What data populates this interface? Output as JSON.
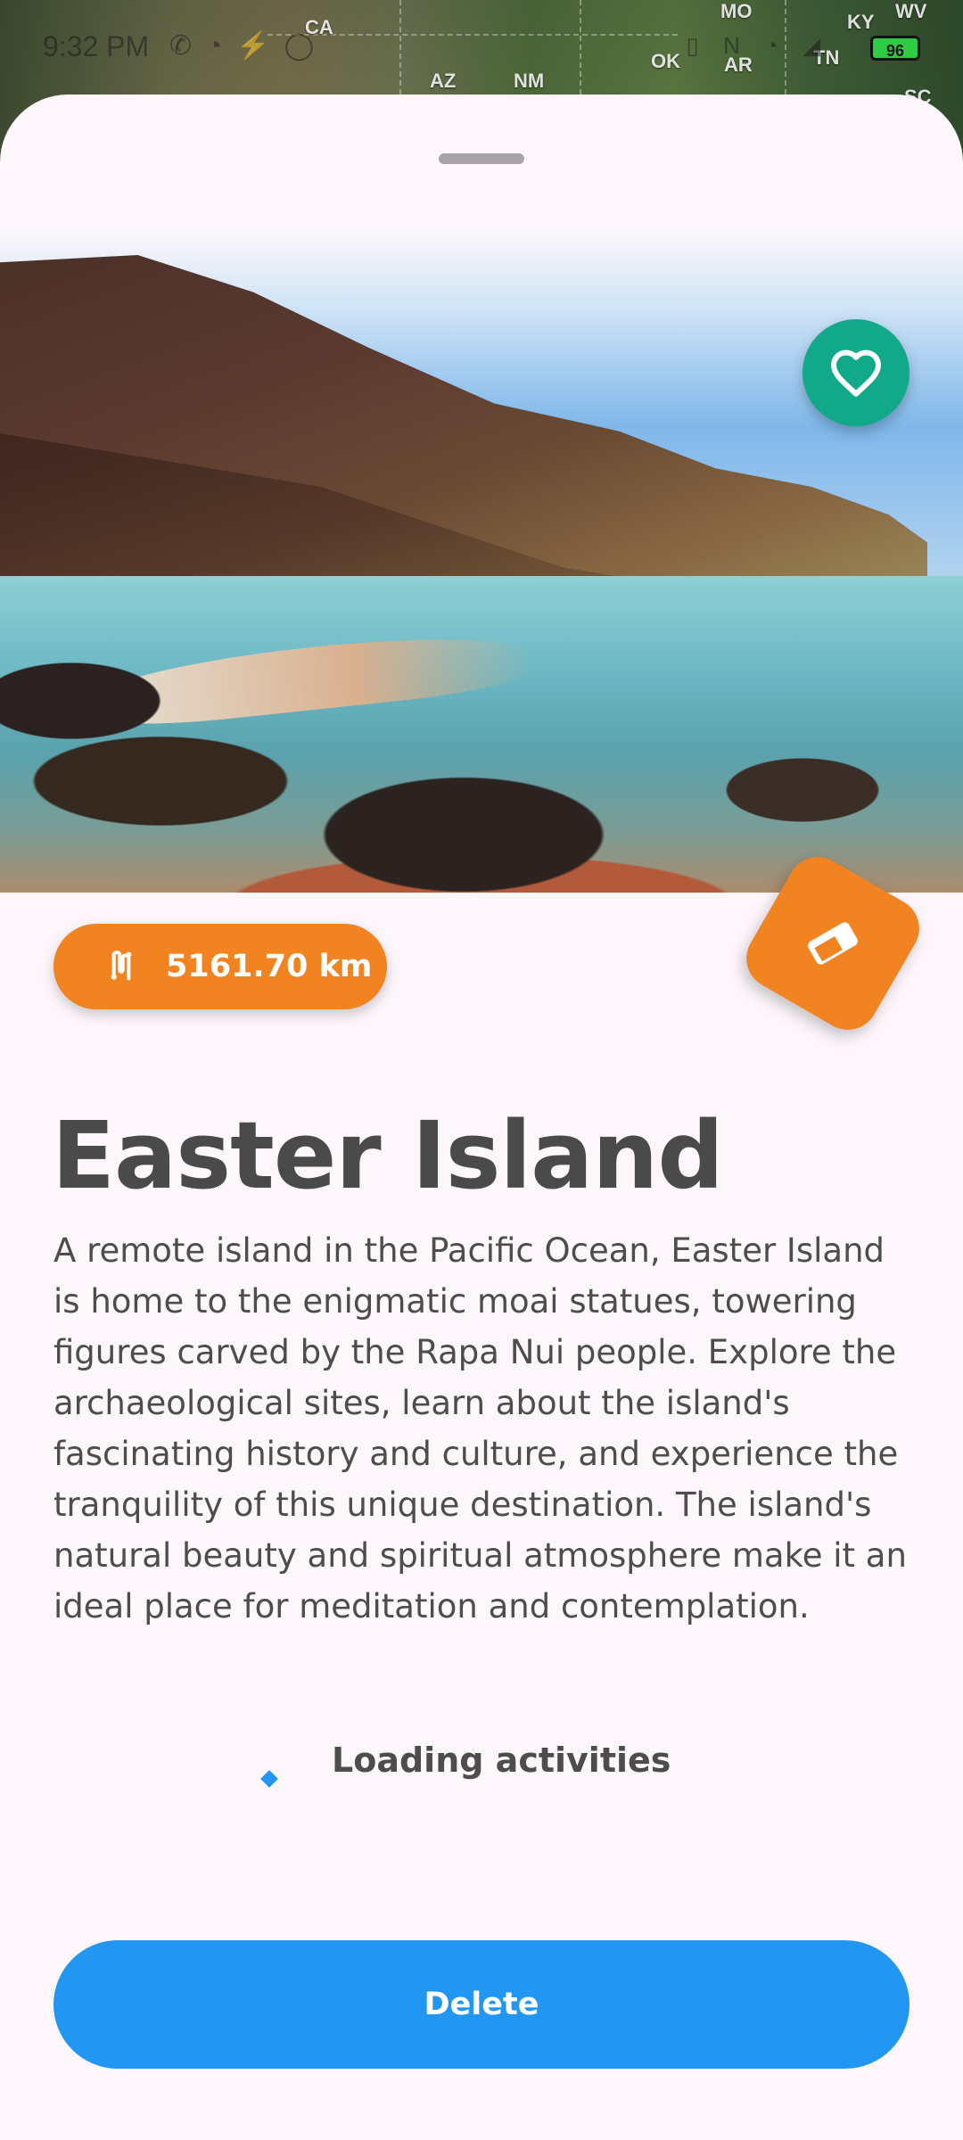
{
  "status_bar": {
    "time": "9:32 PM",
    "battery": "96"
  },
  "map": {
    "labels": [
      "CA",
      "AZ",
      "NM",
      "MO",
      "KY",
      "WV",
      "OK",
      "AR",
      "TN",
      "SC"
    ]
  },
  "place": {
    "distance": "5161.70 km",
    "title": "Easter Island",
    "description": "A remote island in the Pacific Ocean, Easter Island is home to the enigmatic moai statues, towering figures carved by the Rapa Nui people. Explore the archaeological sites, learn about the island's fascinating history and culture, and experience the tranquility of this unique destination. The island's natural beauty and spiritual atmosphere make it an ideal place for meditation and contemplation."
  },
  "activities": {
    "loading_label": "Loading activities"
  },
  "actions": {
    "delete_label": "Delete"
  },
  "icons": {
    "favorite": "heart-outline-icon",
    "distance": "route-icon",
    "map_pin": "eraser-icon"
  },
  "colors": {
    "accent_orange": "#f28321",
    "favorite_green": "#12a98a",
    "primary_blue": "#2196f3",
    "sheet_bg": "#fdf7fb"
  }
}
